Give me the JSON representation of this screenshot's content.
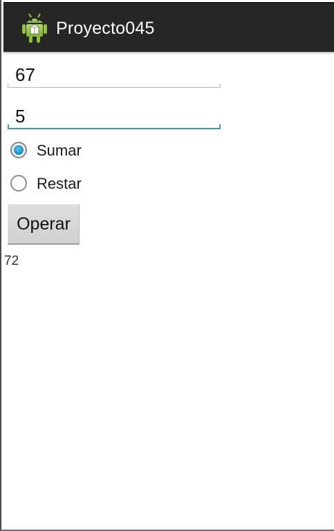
{
  "app": {
    "title": "Proyecto045",
    "icon": "android-robot-icon"
  },
  "form": {
    "first_value": "67",
    "second_value": "5",
    "radio_options": [
      {
        "label": "Sumar",
        "checked": true
      },
      {
        "label": "Restar",
        "checked": false
      }
    ],
    "button_label": "Operar",
    "result": "72"
  },
  "colors": {
    "action_bar": "#262626",
    "focus_accent": "#2f9fca",
    "radio_checked": "#1c95d0"
  }
}
